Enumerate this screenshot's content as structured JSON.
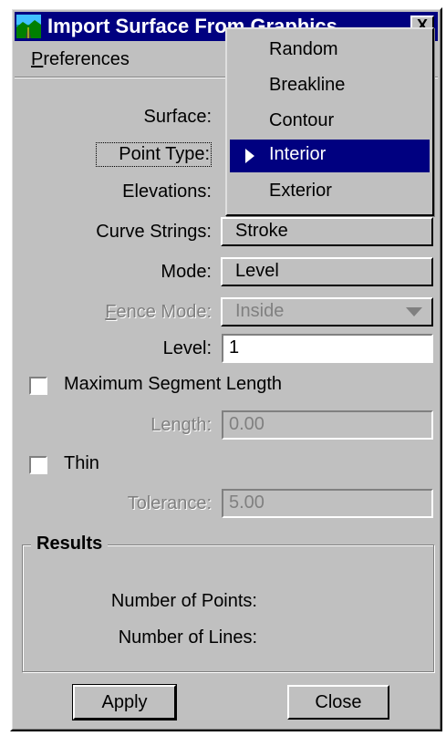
{
  "window": {
    "title": "Import Surface From Graphics",
    "close_glyph": "X",
    "icon": "surface-app-icon"
  },
  "menu": {
    "preferences": "Preferences"
  },
  "form": {
    "surface_label": "Surface:",
    "point_type_label": "Point Type:",
    "elevations_label": "Elevations:",
    "curve_strings_label": "Curve Strings:",
    "curve_strings_value": "Stroke",
    "mode_label": "Mode:",
    "mode_value": "Level",
    "fence_mode_label": "Fence Mode:",
    "fence_mode_value": "Inside",
    "level_label": "Level:",
    "level_value": "1",
    "max_segment_label": "Maximum Segment Length",
    "max_segment_checked": false,
    "length_label": "Length:",
    "length_value": "0.00",
    "thin_label": "Thin",
    "thin_checked": false,
    "tolerance_label": "Tolerance:",
    "tolerance_value": "5.00"
  },
  "results": {
    "title": "Results",
    "num_points_label": "Number of Points:",
    "num_lines_label": "Number of Lines:"
  },
  "buttons": {
    "apply": "Apply",
    "close": "Close"
  },
  "point_type_dropdown": {
    "options": [
      "Random",
      "Breakline",
      "Contour",
      "Interior",
      "Exterior"
    ],
    "selected": "Interior"
  },
  "colors": {
    "titlebar": "#000080",
    "face": "#c0c0c0",
    "selection": "#000080"
  }
}
